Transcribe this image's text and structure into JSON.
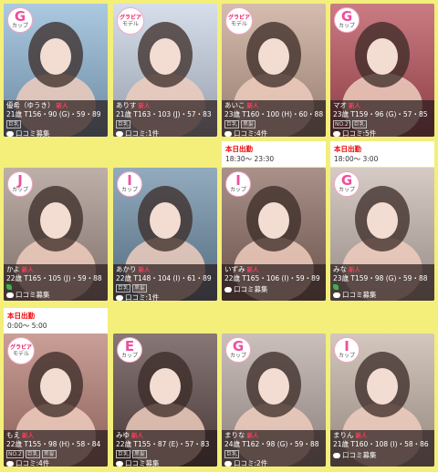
{
  "cards": [
    {
      "name": "優希（ゆうき）",
      "new": "新人",
      "stats": "21歳 T156・90 (G)・59・89",
      "tags": [
        "巨乳"
      ],
      "review": "口コミ募集",
      "badge": "G",
      "badge_sub": "カップ",
      "color": "#8fb8d8",
      "leaf": false
    },
    {
      "name": "ありす",
      "new": "新人",
      "stats": "21歳 T163・103 (J)・57・83",
      "tags": [
        "巨乳"
      ],
      "review": "口コミ:1件",
      "badge": "グラビア",
      "badge_sub": "モデル",
      "color": "#c8d4e4",
      "leaf": false
    },
    {
      "name": "あいこ",
      "new": "新人",
      "stats": "23歳 T160・100 (H)・60・88",
      "tags": [
        "巨乳",
        "黒髪"
      ],
      "review": "口コミ:4件",
      "badge": "グラビア",
      "badge_sub": "モデル",
      "color": "#c7a693",
      "leaf": false
    },
    {
      "name": "マオ",
      "new": "新人",
      "stats": "23歳 T159・96 (G)・57・85",
      "tags": [
        "NO.2",
        "巨乳"
      ],
      "review": "口コミ:5件",
      "badge": "G",
      "badge_sub": "カップ",
      "color": "#b9505a",
      "leaf": false
    },
    {
      "name": "かよ",
      "new": "新人",
      "stats": "22歳 T165・105 (J)・59・88",
      "tags": [],
      "review": "口コミ募集",
      "badge": "J",
      "badge_sub": "カップ",
      "color": "#a8958c",
      "leaf": true
    },
    {
      "name": "あかり",
      "new": "新人",
      "stats": "22歳 T148・104 (I)・61・89",
      "tags": [
        "巨乳",
        "黒髪"
      ],
      "review": "口コミ:1件",
      "badge": "I",
      "badge_sub": "カップ",
      "color": "#6f8fa8",
      "leaf": false
    },
    {
      "name": "いずみ",
      "new": "新人",
      "stats": "22歳 T165・106 (I)・59・89",
      "tags": [],
      "review": "口コミ募集",
      "badge": "I",
      "badge_sub": "カップ",
      "color": "#8d6d63",
      "leaf": false
    },
    {
      "name": "みな",
      "new": "新人",
      "stats": "23歳 T159・98 (G)・59・88",
      "tags": [],
      "review": "口コミ募集",
      "badge": "G",
      "badge_sub": "カップ",
      "color": "#c9b9b2",
      "leaf": true
    },
    {
      "name": "もえ",
      "new": "新人",
      "stats": "22歳 T155・98 (H)・58・84",
      "tags": [
        "NO.2",
        "巨乳",
        "黒髪"
      ],
      "review": "口コミ:4件",
      "badge": "グラビア",
      "badge_sub": "モデル",
      "color": "#b77f74",
      "leaf": false
    },
    {
      "name": "みゆ",
      "new": "新人",
      "stats": "22歳 T155・87 (E)・57・83",
      "tags": [
        "巨乳",
        "黒髪"
      ],
      "review": "口コミ募集",
      "badge": "E",
      "badge_sub": "カップ",
      "color": "#5f4a48",
      "leaf": false
    },
    {
      "name": "まりな",
      "new": "新人",
      "stats": "24歳 T162・98 (G)・59・88",
      "tags": [
        "巨乳"
      ],
      "review": "口コミ:2件",
      "badge": "G",
      "badge_sub": "カップ",
      "color": "#b9aaa4",
      "leaf": false
    },
    {
      "name": "まりん",
      "new": "新人",
      "stats": "21歳 T160・108 (I)・58・86",
      "tags": [],
      "review": "口コミ募集",
      "badge": "I",
      "badge_sub": "カップ",
      "color": "#c4b4a8",
      "leaf": false
    }
  ],
  "shifts": [
    {
      "label": "本日出勤",
      "time": "18:30～ 23:30"
    },
    {
      "label": "本日出勤",
      "time": "18:00～ 3:00"
    },
    {
      "label": "本日出勤",
      "time": "0:00～ 5:00"
    }
  ]
}
